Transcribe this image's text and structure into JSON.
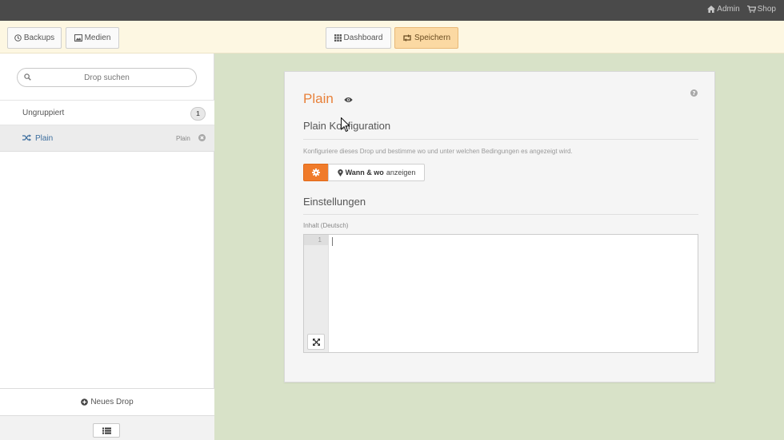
{
  "topbar": {
    "admin_label": "Admin",
    "shop_label": "Shop"
  },
  "toolbar": {
    "backups_label": "Backups",
    "medien_label": "Medien",
    "dashboard_label": "Dashboard",
    "save_label": "Speichern"
  },
  "sidebar": {
    "search_placeholder": "Drop suchen",
    "group": {
      "label": "Ungruppiert",
      "count": "1"
    },
    "drop": {
      "name": "Plain",
      "type": "Plain"
    },
    "new_drop_label": "Neues Drop"
  },
  "panel": {
    "title": "Plain",
    "config_title": "Plain Konfiguration",
    "config_desc": "Konfiguriere dieses Drop und bestimme wo und unter welchen Bedingungen es angezeigt wird.",
    "when_where_bold": "Wann & wo",
    "when_where_rest": "anzeigen",
    "settings_title": "Einstellungen",
    "content_label": "Inhalt (Deutsch)",
    "editor_line": "1"
  },
  "colors": {
    "accent": "#f07b2a",
    "link": "#3d6e9e",
    "background": "#d8e2c8",
    "save_button": "#fbd9a3"
  }
}
